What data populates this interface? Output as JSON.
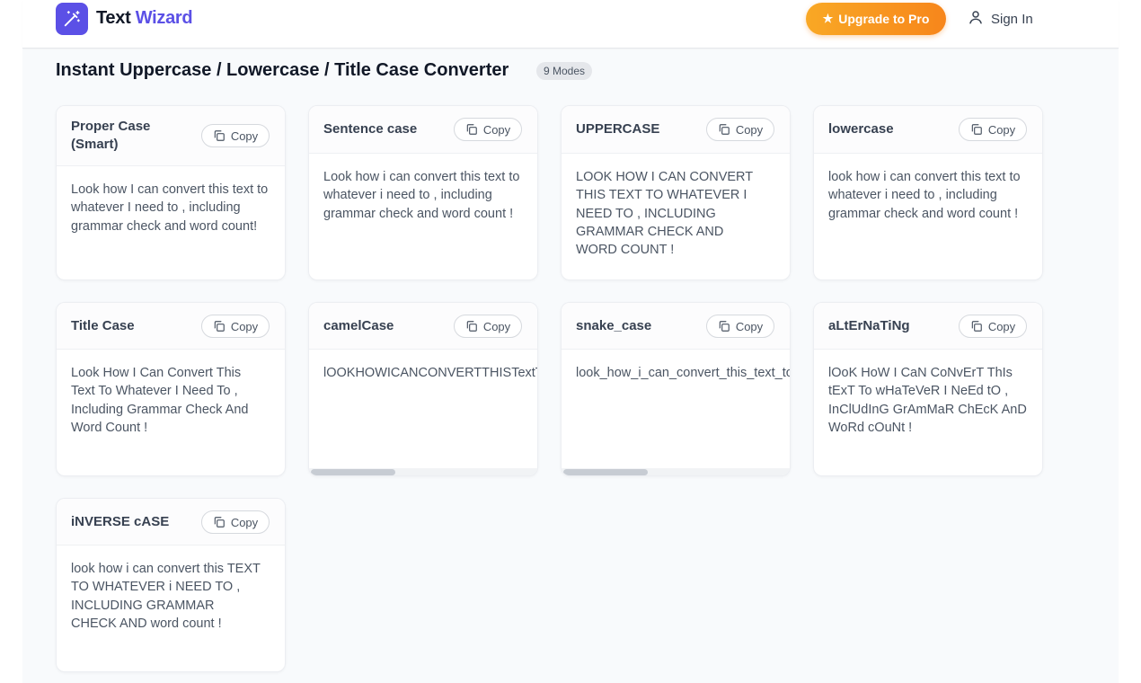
{
  "app": {
    "logo_part1": "Text",
    "logo_part2": "Wizard",
    "upgrade_label": "Upgrade to Pro",
    "signin_label": "Sign In"
  },
  "page": {
    "title": "Instant Uppercase / Lowercase / Title Case Converter",
    "modes_badge": "9 Modes"
  },
  "copy_label": "Copy",
  "colors": {
    "brand": "#5b50e6",
    "upgrade": "#f7861b"
  },
  "cards": [
    {
      "title": "Proper Case (Smart)",
      "text": "Look how I can convert this text to whatever I need to , including grammar check and word count!"
    },
    {
      "title": "Sentence case",
      "text": "Look how i can convert this text to whatever i need to , including grammar check and word count !"
    },
    {
      "title": "UPPERCASE",
      "text": "LOOK HOW I CAN CONVERT THIS TEXT TO WHATEVER I NEED TO , INCLUDING GRAMMAR CHECK AND WORD COUNT !"
    },
    {
      "title": "lowercase",
      "text": "look how i can convert this text to whatever i need to , including grammar check and word count !"
    },
    {
      "title": "Title Case",
      "text": "Look How I Can Convert This Text To Whatever I Need To , Including Grammar Check And Word Count !"
    },
    {
      "title": "camelCase",
      "text": "lOOKHOWICANCONVERTTHISTextToWhateverINeedToIncludingGrammarCheckAndWordCount"
    },
    {
      "title": "snake_case",
      "text": "look_how_i_can_convert_this_text_to_whatever_i_need_to_including_grammar_check_and_word_count"
    },
    {
      "title": "aLtErNaTiNg",
      "text": "lOoK HoW I CaN CoNvErT ThIs tExT To wHaTeVeR I NeEd tO , InClUdInG GrAmMaR ChEcK AnD WoRd cOuNt !"
    },
    {
      "title": "iNVERSE cASE",
      "text": "look how i can convert this TEXT TO WHATEVER i NEED TO , INCLUDING GRAMMAR CHECK AND word count !"
    }
  ]
}
